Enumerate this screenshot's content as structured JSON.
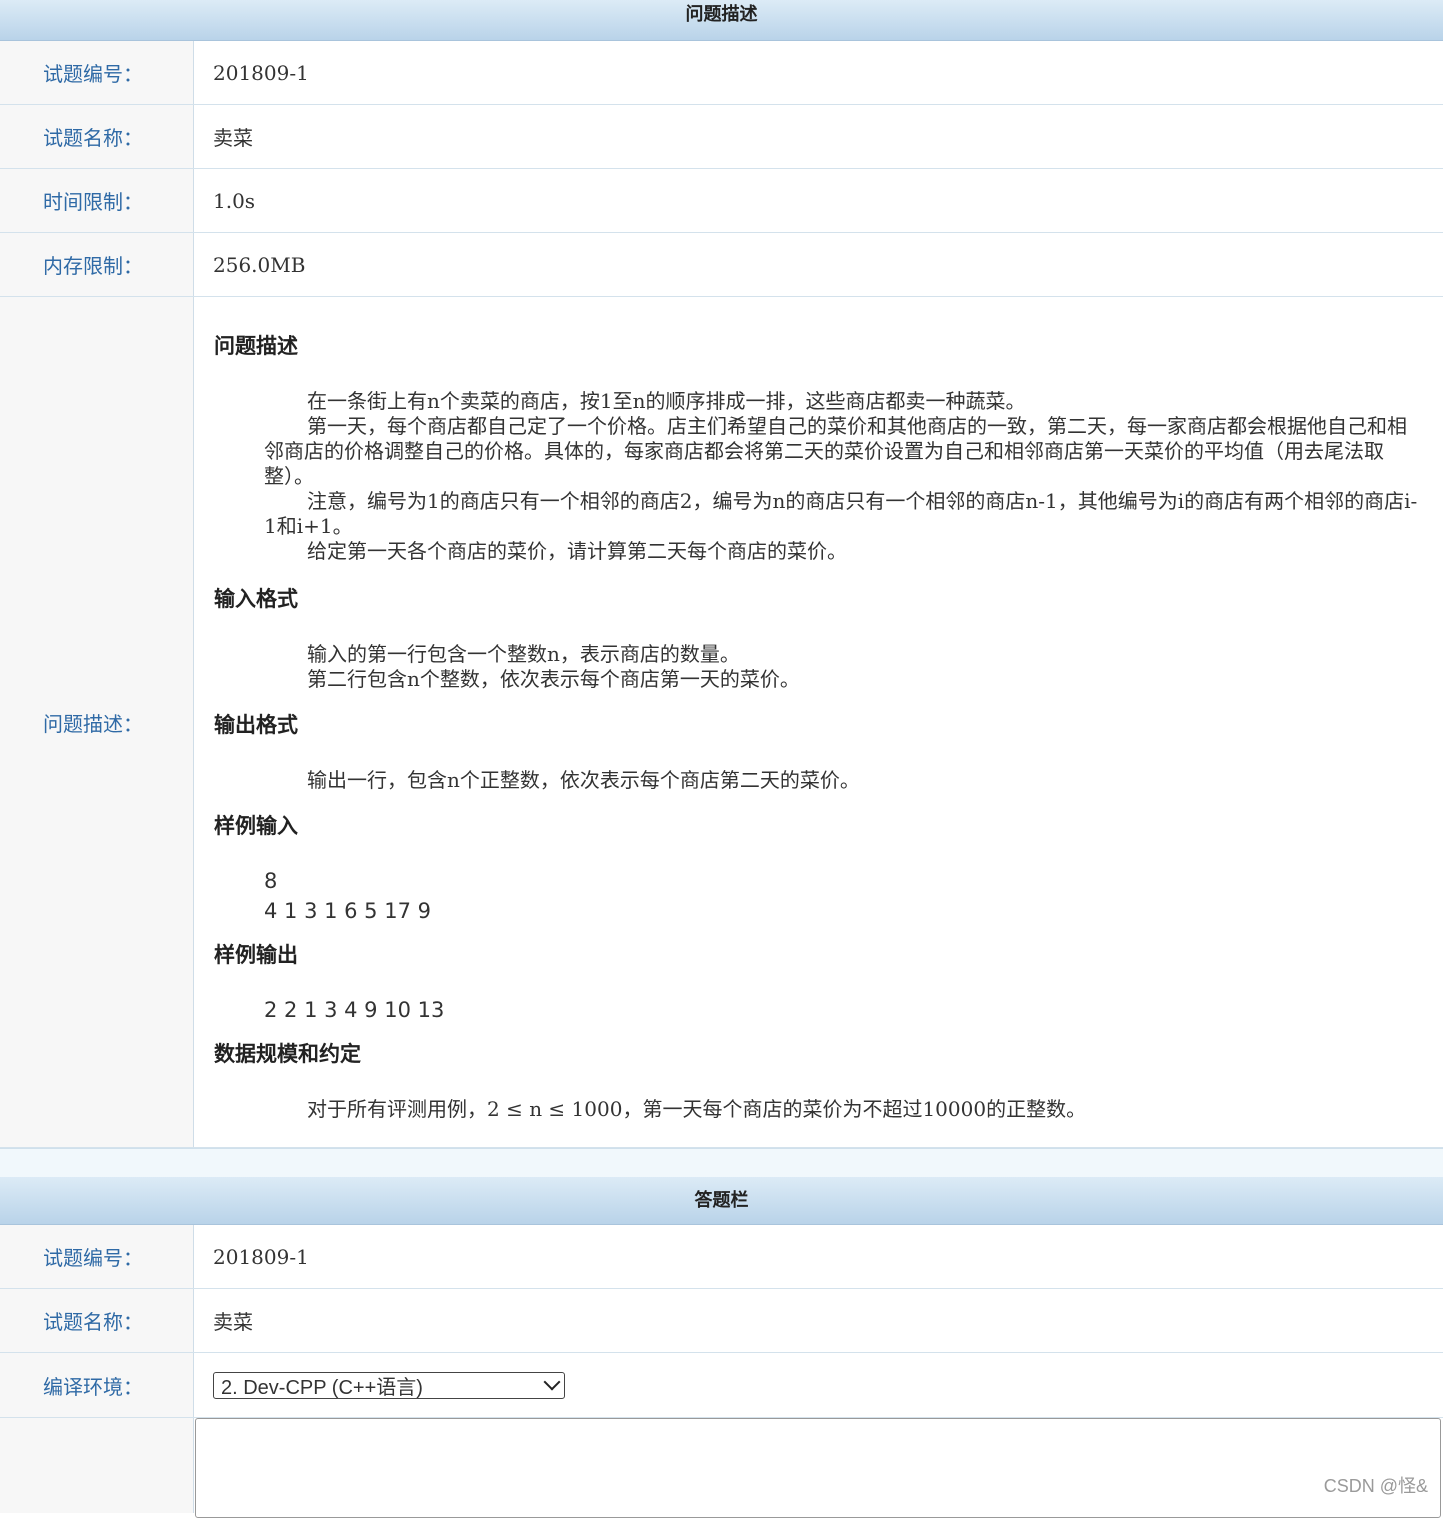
{
  "problem_section": {
    "header": "问题描述",
    "rows": {
      "id_label": "试题编号：",
      "id_value": "201809-1",
      "name_label": "试题名称：",
      "name_value": "卖菜",
      "time_label": "时间限制：",
      "time_value": "1.0s",
      "mem_label": "内存限制：",
      "mem_value": "256.0MB",
      "desc_label": "问题描述："
    },
    "description": {
      "h_problem": "问题描述",
      "p1": "在一条街上有n个卖菜的商店，按1至n的顺序排成一排，这些商店都卖一种蔬菜。",
      "p2": "第一天，每个商店都自己定了一个价格。店主们希望自己的菜价和其他商店的一致，第二天，每一家商店都会根据他自己和相邻商店的价格调整自己的价格。具体的，每家商店都会将第二天的菜价设置为自己和相邻商店第一天菜价的平均值（用去尾法取整）。",
      "p3": "注意，编号为1的商店只有一个相邻的商店2，编号为n的商店只有一个相邻的商店n-1，其他编号为i的商店有两个相邻的商店i-1和i+1。",
      "p4": "给定第一天各个商店的菜价，请计算第二天每个商店的菜价。",
      "h_input": "输入格式",
      "in1": "输入的第一行包含一个整数n，表示商店的数量。",
      "in2": "第二行包含n个整数，依次表示每个商店第一天的菜价。",
      "h_output": "输出格式",
      "out1": "输出一行，包含n个正整数，依次表示每个商店第二天的菜价。",
      "h_sample_in": "样例输入",
      "sample_in_1": "8",
      "sample_in_2": "4 1 3 1 6 5 17 9",
      "h_sample_out": "样例输出",
      "sample_out": "2 2 1 3 4 9 10 13",
      "h_scale": "数据规模和约定",
      "scale": "对于所有评测用例，2 ≤ n ≤ 1000，第一天每个商店的菜价为不超过10000的正整数。"
    }
  },
  "answer_section": {
    "header": "答题栏",
    "id_label": "试题编号：",
    "id_value": "201809-1",
    "name_label": "试题名称：",
    "name_value": "卖菜",
    "env_label": "编译环境：",
    "env_selected": "2. Dev-CPP (C++语言)"
  },
  "watermark": "CSDN @怪&"
}
